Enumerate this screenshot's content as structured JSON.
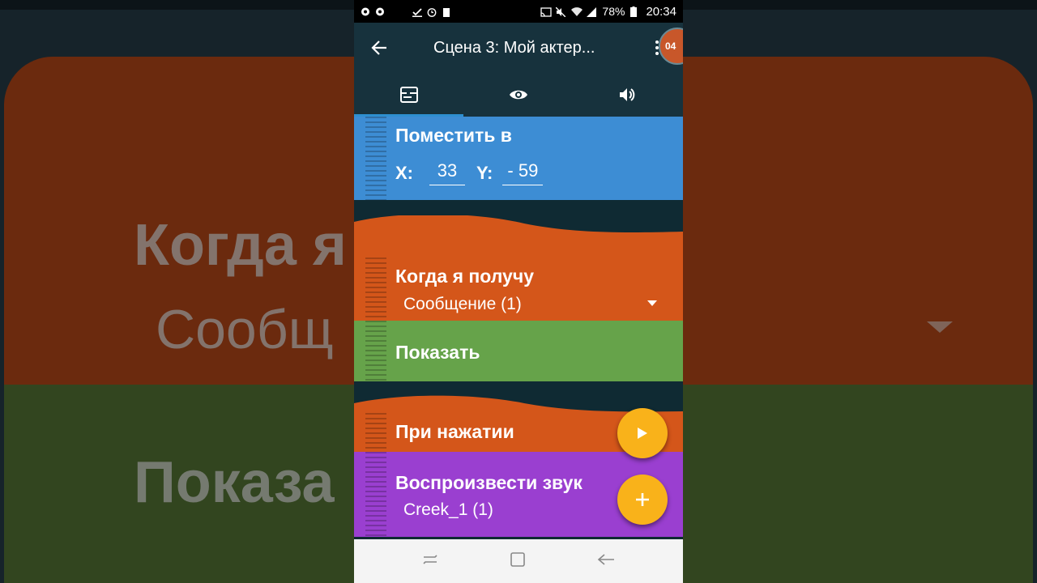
{
  "status_bar": {
    "battery": "78%",
    "time": "20:34"
  },
  "app_bar": {
    "title": "Сцена 3: Мой актер...",
    "badge": "04"
  },
  "tabs": [
    {
      "icon": "script-icon",
      "active": true
    },
    {
      "icon": "eye-icon",
      "active": false
    },
    {
      "icon": "speaker-icon",
      "active": false
    }
  ],
  "bricks": {
    "place_at": {
      "title": "Поместить в",
      "x_label": "X:",
      "x_value": "33",
      "y_label": "Y:",
      "y_value": "- 59",
      "color": "#3d8dd4"
    },
    "when_receive": {
      "title": "Когда я получу",
      "message": "Сообщение (1)",
      "color": "#d4561a"
    },
    "show": {
      "title": "Показать",
      "color": "#66a34a"
    },
    "when_tapped": {
      "title": "При нажатии",
      "color": "#d4561a"
    },
    "play_sound": {
      "title": "Воспроизвести звук",
      "sound": "Creek_1 (1)",
      "color": "#9a3fd0"
    }
  },
  "background": {
    "title1": "Когда я",
    "title2": "Сообщ",
    "title3": "Показа"
  },
  "fab_color": "#f9b21a"
}
